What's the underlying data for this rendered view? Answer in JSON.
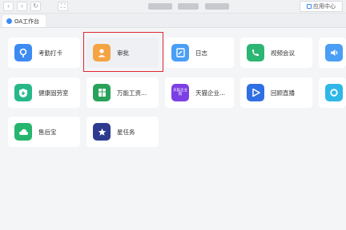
{
  "topbar": {
    "back_glyph": "‹",
    "forward_glyph": "›",
    "refresh_glyph": "↻",
    "fullscreen_glyph": "⛶",
    "app_center_label": "应用中心"
  },
  "tab": {
    "label": "OA工作台"
  },
  "apps": [
    {
      "label": "考勤打卡",
      "icon": "location-pin-icon",
      "color": "#3d8bf2"
    },
    {
      "label": "审批",
      "icon": "person-icon",
      "color": "#f5a443",
      "selected": true
    },
    {
      "label": "日志",
      "icon": "notepad-icon",
      "color": "#4a9ef5"
    },
    {
      "label": "视频会议",
      "icon": "phone-icon",
      "color": "#2bb673"
    },
    {
      "label": "",
      "icon": "speaker-icon",
      "color": "#4a9ef5"
    },
    {
      "label": "健康固劳室",
      "icon": "shield-plus-icon",
      "color": "#27b889"
    },
    {
      "label": "万能工资...",
      "icon": "spreadsheet-icon",
      "color": "#28a25a"
    },
    {
      "label": "天猫企业...",
      "icon": "tmall-icon",
      "color": "#7b3fe4",
      "icon_text": "天猫企业购"
    },
    {
      "label": "回顾直播",
      "icon": "play-icon",
      "color": "#2f6fe3"
    },
    {
      "label": "",
      "icon": "ring-icon",
      "color": "#2fb7e8"
    },
    {
      "label": "售后宝",
      "icon": "cloud-icon",
      "color": "#26b56d"
    },
    {
      "label": "星任务",
      "icon": "star-icon",
      "color": "#2d3b8f"
    }
  ]
}
